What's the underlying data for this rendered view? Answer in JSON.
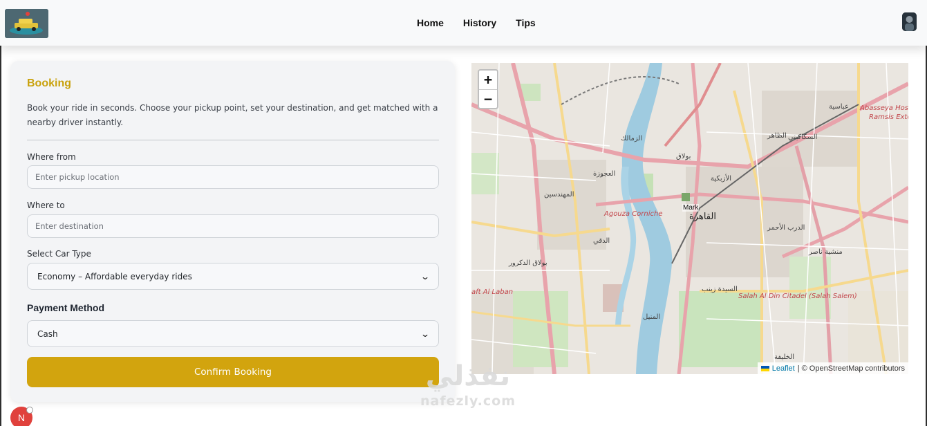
{
  "nav": {
    "home": "Home",
    "history": "History",
    "tips": "Tips"
  },
  "booking": {
    "title": "Booking",
    "description": "Book your ride in seconds. Choose your pickup point, set your destination, and get matched with a nearby driver instantly.",
    "from_label": "Where from",
    "from_placeholder": "Enter pickup location",
    "to_label": "Where to",
    "to_placeholder": "Enter destination",
    "car_label": "Select Car Type",
    "car_selected": "Economy – Affordable everyday rides",
    "payment_label": "Payment Method",
    "payment_selected": "Cash",
    "confirm_label": "Confirm Booking"
  },
  "map": {
    "zoom_in": "+",
    "zoom_out": "−",
    "marker_label": "Mark",
    "attribution_link": "Leaflet",
    "attribution_rest": "| © OpenStreetMap contributors",
    "labels": {
      "cairo": "القاهرة",
      "zamalek": "الزمالك",
      "agouza": "العجوزة",
      "mohandessin": "المهندسين",
      "dokki": "الدقي",
      "bulaq": "بولاق",
      "sakakini": "السكاكيني",
      "zaher": "الظاهر",
      "abbasia": "عباسية",
      "agouza_corniche": "Agouza Corniche",
      "abbassia_hospital": "Abasseya Hospital",
      "ramsis": "Ramsis Extens",
      "salah_al_din": "Salah Al Din Citadel (Salah Salem)",
      "al_laban": "aft Al Laban",
      "sayeda_zeinab": "السيدة زينب",
      "manial": "المنيل",
      "bulaq_dakrour": "بولاق الدكرور",
      "manshiyat_nasser": "منشية ناصر",
      "darb_al_ahmar": "الدرب الأحمر",
      "khalifa": "الخليفة",
      "azbakeya": "الأزبكية"
    }
  },
  "watermark": {
    "arabic": "نفذلي",
    "latin": "nafezly.com"
  },
  "badge": {
    "letter": "N"
  },
  "colors": {
    "accent": "#d2a40e",
    "title": "#c9a20d",
    "badge": "#e0413c"
  }
}
